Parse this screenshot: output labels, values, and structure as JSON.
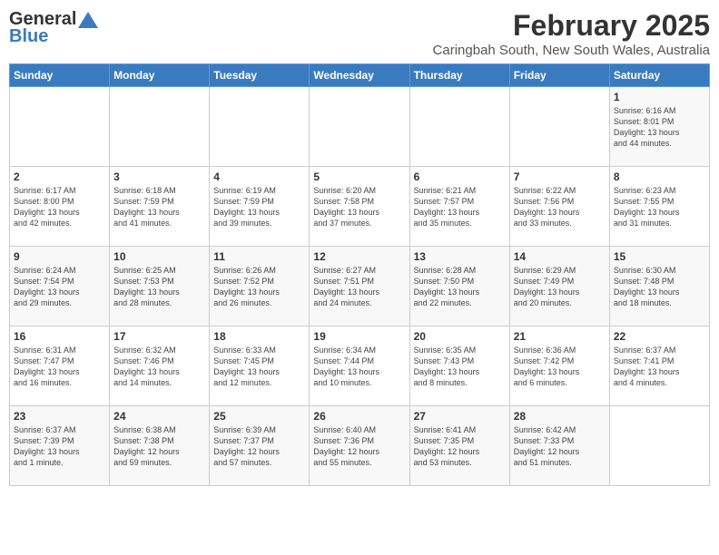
{
  "header": {
    "logo_general": "General",
    "logo_blue": "Blue",
    "month_year": "February 2025",
    "location": "Caringbah South, New South Wales, Australia"
  },
  "weekdays": [
    "Sunday",
    "Monday",
    "Tuesday",
    "Wednesday",
    "Thursday",
    "Friday",
    "Saturday"
  ],
  "weeks": [
    [
      {
        "day": "",
        "info": ""
      },
      {
        "day": "",
        "info": ""
      },
      {
        "day": "",
        "info": ""
      },
      {
        "day": "",
        "info": ""
      },
      {
        "day": "",
        "info": ""
      },
      {
        "day": "",
        "info": ""
      },
      {
        "day": "1",
        "info": "Sunrise: 6:16 AM\nSunset: 8:01 PM\nDaylight: 13 hours\nand 44 minutes."
      }
    ],
    [
      {
        "day": "2",
        "info": "Sunrise: 6:17 AM\nSunset: 8:00 PM\nDaylight: 13 hours\nand 42 minutes."
      },
      {
        "day": "3",
        "info": "Sunrise: 6:18 AM\nSunset: 7:59 PM\nDaylight: 13 hours\nand 41 minutes."
      },
      {
        "day": "4",
        "info": "Sunrise: 6:19 AM\nSunset: 7:59 PM\nDaylight: 13 hours\nand 39 minutes."
      },
      {
        "day": "5",
        "info": "Sunrise: 6:20 AM\nSunset: 7:58 PM\nDaylight: 13 hours\nand 37 minutes."
      },
      {
        "day": "6",
        "info": "Sunrise: 6:21 AM\nSunset: 7:57 PM\nDaylight: 13 hours\nand 35 minutes."
      },
      {
        "day": "7",
        "info": "Sunrise: 6:22 AM\nSunset: 7:56 PM\nDaylight: 13 hours\nand 33 minutes."
      },
      {
        "day": "8",
        "info": "Sunrise: 6:23 AM\nSunset: 7:55 PM\nDaylight: 13 hours\nand 31 minutes."
      }
    ],
    [
      {
        "day": "9",
        "info": "Sunrise: 6:24 AM\nSunset: 7:54 PM\nDaylight: 13 hours\nand 29 minutes."
      },
      {
        "day": "10",
        "info": "Sunrise: 6:25 AM\nSunset: 7:53 PM\nDaylight: 13 hours\nand 28 minutes."
      },
      {
        "day": "11",
        "info": "Sunrise: 6:26 AM\nSunset: 7:52 PM\nDaylight: 13 hours\nand 26 minutes."
      },
      {
        "day": "12",
        "info": "Sunrise: 6:27 AM\nSunset: 7:51 PM\nDaylight: 13 hours\nand 24 minutes."
      },
      {
        "day": "13",
        "info": "Sunrise: 6:28 AM\nSunset: 7:50 PM\nDaylight: 13 hours\nand 22 minutes."
      },
      {
        "day": "14",
        "info": "Sunrise: 6:29 AM\nSunset: 7:49 PM\nDaylight: 13 hours\nand 20 minutes."
      },
      {
        "day": "15",
        "info": "Sunrise: 6:30 AM\nSunset: 7:48 PM\nDaylight: 13 hours\nand 18 minutes."
      }
    ],
    [
      {
        "day": "16",
        "info": "Sunrise: 6:31 AM\nSunset: 7:47 PM\nDaylight: 13 hours\nand 16 minutes."
      },
      {
        "day": "17",
        "info": "Sunrise: 6:32 AM\nSunset: 7:46 PM\nDaylight: 13 hours\nand 14 minutes."
      },
      {
        "day": "18",
        "info": "Sunrise: 6:33 AM\nSunset: 7:45 PM\nDaylight: 13 hours\nand 12 minutes."
      },
      {
        "day": "19",
        "info": "Sunrise: 6:34 AM\nSunset: 7:44 PM\nDaylight: 13 hours\nand 10 minutes."
      },
      {
        "day": "20",
        "info": "Sunrise: 6:35 AM\nSunset: 7:43 PM\nDaylight: 13 hours\nand 8 minutes."
      },
      {
        "day": "21",
        "info": "Sunrise: 6:36 AM\nSunset: 7:42 PM\nDaylight: 13 hours\nand 6 minutes."
      },
      {
        "day": "22",
        "info": "Sunrise: 6:37 AM\nSunset: 7:41 PM\nDaylight: 13 hours\nand 4 minutes."
      }
    ],
    [
      {
        "day": "23",
        "info": "Sunrise: 6:37 AM\nSunset: 7:39 PM\nDaylight: 13 hours\nand 1 minute."
      },
      {
        "day": "24",
        "info": "Sunrise: 6:38 AM\nSunset: 7:38 PM\nDaylight: 12 hours\nand 59 minutes."
      },
      {
        "day": "25",
        "info": "Sunrise: 6:39 AM\nSunset: 7:37 PM\nDaylight: 12 hours\nand 57 minutes."
      },
      {
        "day": "26",
        "info": "Sunrise: 6:40 AM\nSunset: 7:36 PM\nDaylight: 12 hours\nand 55 minutes."
      },
      {
        "day": "27",
        "info": "Sunrise: 6:41 AM\nSunset: 7:35 PM\nDaylight: 12 hours\nand 53 minutes."
      },
      {
        "day": "28",
        "info": "Sunrise: 6:42 AM\nSunset: 7:33 PM\nDaylight: 12 hours\nand 51 minutes."
      },
      {
        "day": "",
        "info": ""
      }
    ]
  ]
}
